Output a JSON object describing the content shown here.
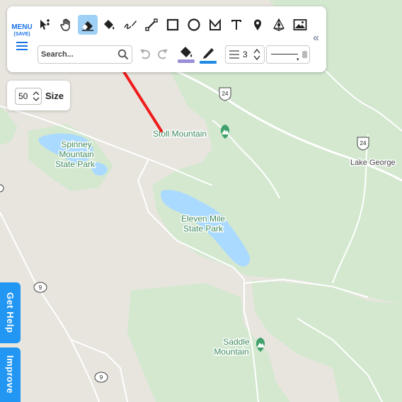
{
  "menu": {
    "label": "MENU",
    "sublabel": "(SAVE)"
  },
  "toolbar": {
    "tools": [
      {
        "name": "select-move-tool",
        "icon": "select-move-icon",
        "active": false
      },
      {
        "name": "pan-tool",
        "icon": "hand-icon",
        "active": false
      },
      {
        "name": "eraser-tool",
        "icon": "eraser-icon",
        "active": true
      },
      {
        "name": "fill-tool",
        "icon": "paint-bucket-icon",
        "active": false
      },
      {
        "name": "freehand-tool",
        "icon": "freehand-pen-icon",
        "active": false
      },
      {
        "name": "line-tool",
        "icon": "line-icon",
        "active": false
      },
      {
        "name": "rectangle-tool",
        "icon": "rectangle-icon",
        "active": false
      },
      {
        "name": "circle-tool",
        "icon": "circle-icon",
        "active": false
      },
      {
        "name": "polygon-tool",
        "icon": "polygon-icon",
        "active": false
      },
      {
        "name": "text-tool",
        "icon": "text-icon",
        "active": false
      },
      {
        "name": "marker-tool",
        "icon": "map-pin-icon",
        "active": false
      },
      {
        "name": "3d-shape-tool",
        "icon": "3d-shape-icon",
        "active": false
      },
      {
        "name": "image-tool",
        "icon": "image-icon",
        "active": false
      }
    ],
    "collapse_label": "«"
  },
  "search": {
    "placeholder": "Search..."
  },
  "line_width": {
    "value": "3"
  },
  "colors": {
    "fill": "#9a8fd6",
    "stroke": "#1e88e5",
    "accent": "#2196f3",
    "active_tool": "#9fd0f6",
    "arrow": "#ee1c1c"
  },
  "size_panel": {
    "value": "50",
    "label": "Size"
  },
  "side_tabs": {
    "help": "Get Help",
    "improve": "Improve"
  },
  "map": {
    "labels": {
      "stoll": "Stoll Mountain",
      "spinney_1": "Spinney",
      "spinney_2": "Mountain",
      "spinney_3": "State Park",
      "eleven_1": "Eleven Mile",
      "eleven_2": "State Park",
      "lake_george": "Lake George",
      "saddle_1": "Saddle",
      "saddle_2": "Mountain"
    },
    "shields": {
      "us24": "24",
      "road9": "9"
    }
  }
}
